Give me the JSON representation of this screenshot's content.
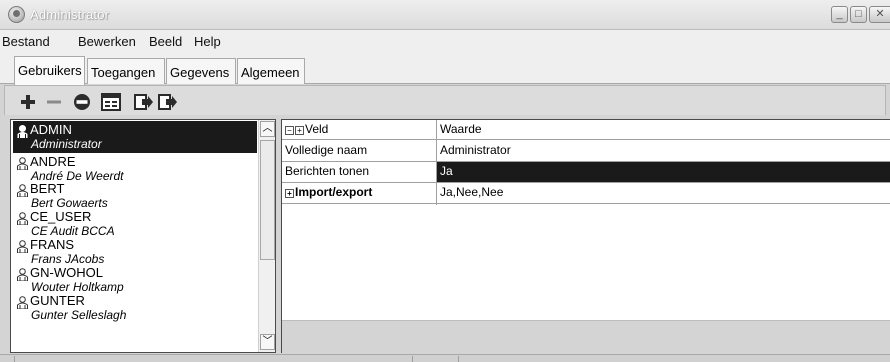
{
  "window": {
    "title": "Administrator"
  },
  "menu": [
    "Bestand",
    "Bewerken",
    "Beeld",
    "Help"
  ],
  "tabs": [
    {
      "label": "Gebruikers",
      "active": true
    },
    {
      "label": "Toegangen",
      "active": false
    },
    {
      "label": "Gegevens",
      "active": false
    },
    {
      "label": "Algemeen",
      "active": false
    }
  ],
  "toolbar": {
    "icons": [
      "add-icon",
      "remove-icon",
      "disable-icon",
      "properties-icon",
      "import-icon",
      "export-icon"
    ]
  },
  "users": [
    {
      "login": "ADMIN",
      "full_name": "Administrator",
      "selected": true
    },
    {
      "login": "ANDRE",
      "full_name": "André De Weerdt",
      "selected": false
    },
    {
      "login": "BERT",
      "full_name": "Bert Gowaerts",
      "selected": false
    },
    {
      "login": "CE_USER",
      "full_name": "CE Audit BCCA",
      "selected": false
    },
    {
      "login": "FRANS",
      "full_name": "Frans JAcobs",
      "selected": false
    },
    {
      "login": "GN-WOHOL",
      "full_name": "Wouter Holtkamp",
      "selected": false
    },
    {
      "login": "GUNTER",
      "full_name": "Gunter Selleslagh",
      "selected": false
    }
  ],
  "properties": {
    "header": {
      "field": "Veld",
      "value": "Waarde"
    },
    "rows": [
      {
        "field": "Volledige naam",
        "value": "Administrator",
        "selected": false,
        "bold": false,
        "expandable": false
      },
      {
        "field": "Berichten tonen",
        "value": "Ja",
        "selected": true,
        "bold": false,
        "expandable": false
      },
      {
        "field": "Import/export",
        "value": "Ja,Nee,Nee",
        "selected": false,
        "bold": true,
        "expandable": true
      }
    ]
  }
}
